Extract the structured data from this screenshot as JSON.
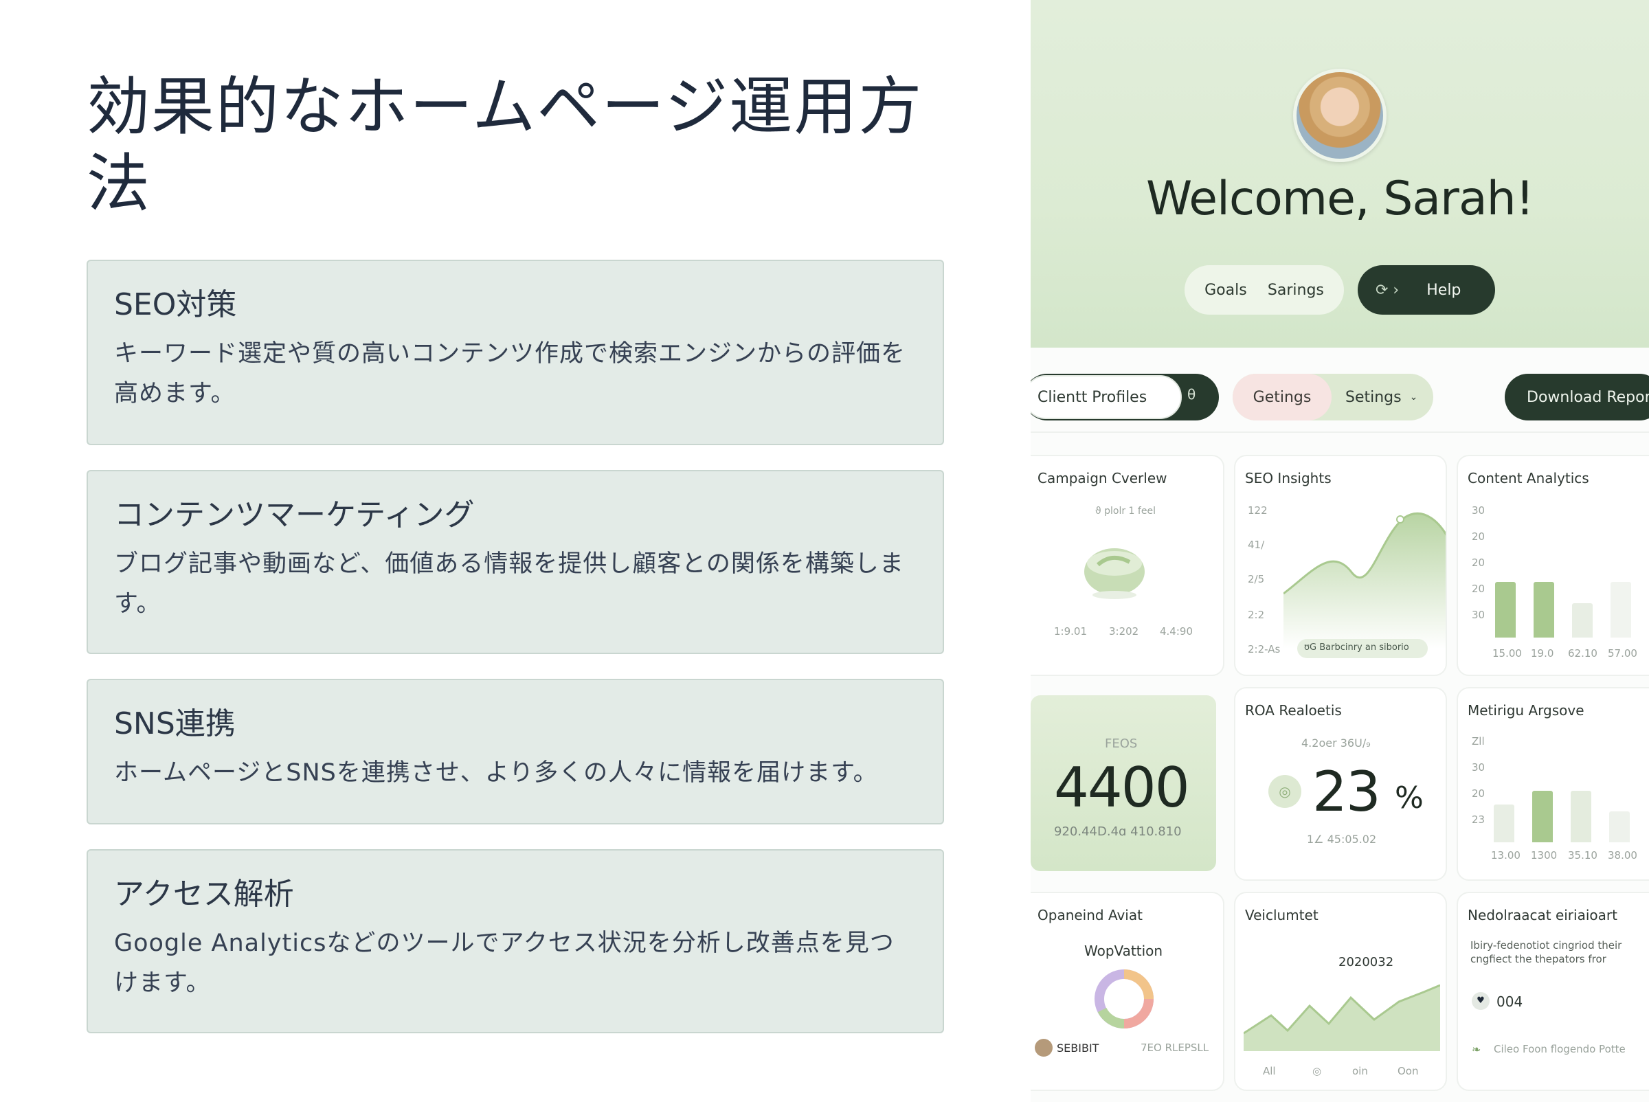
{
  "slide": {
    "title": "効果的なホームページ運用方法",
    "cards": [
      {
        "title": "SEO対策",
        "text": "キーワード選定や質の高いコンテンツ作成で検索エンジンからの評価を高めます。"
      },
      {
        "title": "コンテンツマーケティング",
        "text": "ブログ記事や動画など、価値ある情報を提供し顧客との関係を構築します。"
      },
      {
        "title": "SNS連携",
        "text": "ホームページとSNSを連携させ、より多くの人々に情報を届けます。"
      },
      {
        "title": "アクセス解析",
        "text": "Google Analyticsなどのツールでアクセス状況を分析し改善点を見つけます。"
      }
    ]
  },
  "dashboard": {
    "welcome": "Welcome, Sarah!",
    "nav": {
      "goals": "Goals",
      "settings": "Sarings",
      "help": "Help"
    },
    "toolbar": {
      "client_profiles": "Clientt Profiles",
      "client_icon": "θ",
      "seg_a": "Getings",
      "seg_b": "Setings",
      "download": "Download Report"
    },
    "campaign": {
      "title": "Campaign Cverlew",
      "sub": "ϑ plolr 1 feel",
      "labels": [
        "1:9.01",
        "3:202",
        "4.4:90"
      ]
    },
    "seo": {
      "title": "SEO Insights",
      "y_ticks": [
        "122",
        "41/",
        "2/5",
        "2:2",
        "2:2-As"
      ],
      "badge": "ʊG Barbcinry an siborio"
    },
    "content": {
      "title": "Content Analytics",
      "y_ticks": [
        "30",
        "20",
        "20",
        "20",
        "30"
      ],
      "x_ticks": [
        "15.00",
        "19.0",
        "62.10",
        "57.00"
      ],
      "values": [
        0.74,
        0.74,
        0.45,
        0.74
      ]
    },
    "feos": {
      "label": "FEOS",
      "value": "4400",
      "sub": "920.44D.4ɑ 410.810"
    },
    "roa": {
      "title": "ROA Realoetis",
      "sub": "4.2oer 36U/₉",
      "value": "23",
      "unit": "%",
      "foot": "1∠ 45:05.02"
    },
    "metrics": {
      "title": "Metirigu Argsove",
      "y_ticks": [
        "Zll",
        "30",
        "20",
        "23"
      ],
      "x_ticks": [
        "13.00",
        "1300",
        "35.10",
        "38.00"
      ],
      "values": [
        0.55,
        0.75,
        0.75,
        0.45
      ]
    },
    "open": {
      "title": "Opaneind Aviat",
      "sub": "WopVattion",
      "user": "SEBIBIT",
      "right": "7EO RLEPSLL"
    },
    "vel": {
      "title": "Veiclumtet",
      "value": "2020032",
      "x_ticks": [
        "All",
        "◎",
        "oin",
        "Oon"
      ]
    },
    "notif": {
      "title": "Nedolraacat eiriaioart",
      "text": "Ibiry-fedenotiot cingriod their cngfiect the thepators fror",
      "count": "004",
      "link": "Cileo Foon flogendo Potte"
    },
    "colors": {
      "accent": "#273a2d",
      "green": "#a9c98f",
      "hero": "#dcebd3"
    }
  }
}
